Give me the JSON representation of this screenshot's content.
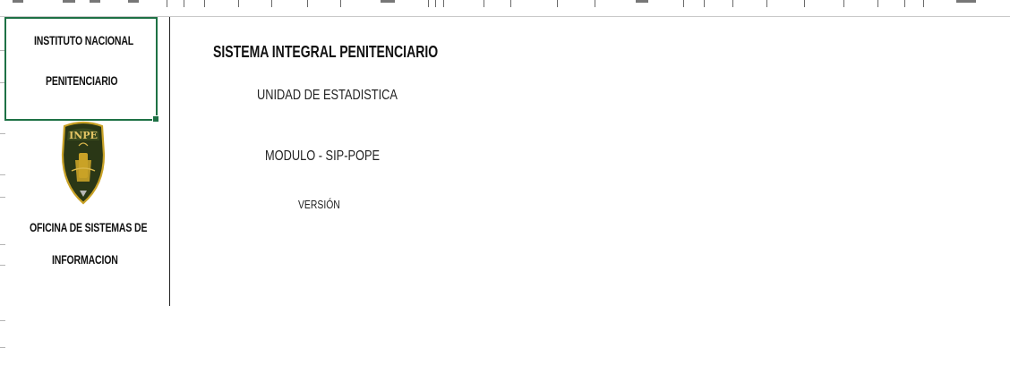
{
  "sheet": {
    "left_panel": {
      "institution_line1": "INSTITUTO NACIONAL",
      "institution_line2": "PENITENCIARIO",
      "logo_icon": "inpe-shield-icon",
      "logo_text": "INPE",
      "office_line1": "OFICINA DE  SISTEMAS DE",
      "office_line2": "INFORMACION"
    },
    "main": {
      "title": "SISTEMA INTEGRAL PENITENCIARIO",
      "unit": "UNIDAD DE ESTADISTICA",
      "module": "MODULO - SIP-POPE",
      "version_label": "VERSIÓN"
    },
    "colors": {
      "selection": "#1e7145",
      "shield_dark": "#1f2a12",
      "shield_gold": "#c9a227"
    }
  }
}
